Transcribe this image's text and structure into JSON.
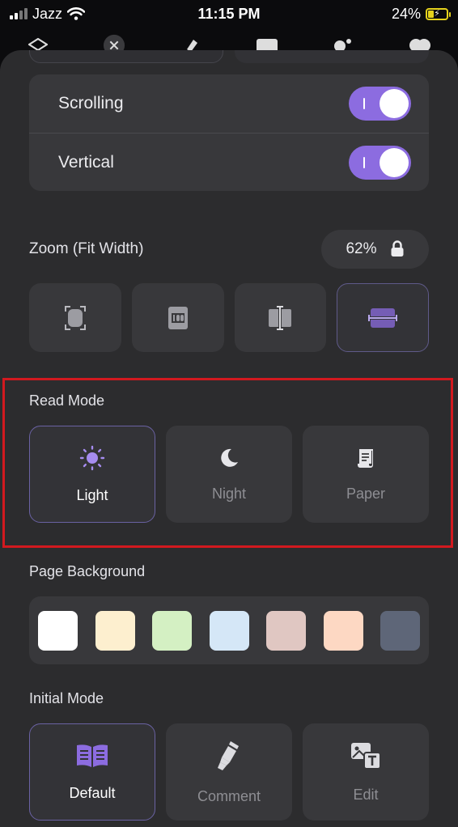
{
  "status_bar": {
    "carrier": "Jazz",
    "time": "11:15 PM",
    "battery_percent": "24%",
    "battery_level": 0.24,
    "battery_color": "#e5d21c"
  },
  "toolbar": {
    "icons": [
      "layers-icon",
      "close-icon",
      "highlighter-icon",
      "image-icon",
      "sparkles-icon",
      "bookmark-icon"
    ]
  },
  "scrolling_card": {
    "rows": [
      {
        "label": "Scrolling",
        "on": true
      },
      {
        "label": "Vertical",
        "on": true
      }
    ],
    "accent": "#8c6ce0"
  },
  "zoom": {
    "label": "Zoom (Fit Width)",
    "value": "62%",
    "lock_icon": "lock-icon",
    "buttons": [
      {
        "icon": "fit-page-icon",
        "active": false
      },
      {
        "icon": "actual-size-icon",
        "active": false
      },
      {
        "icon": "fit-height-icon",
        "active": false
      },
      {
        "icon": "fit-width-icon",
        "active": true
      }
    ]
  },
  "read_mode": {
    "title": "Read Mode",
    "options": [
      {
        "label": "Light",
        "icon": "sun-icon",
        "active": true
      },
      {
        "label": "Night",
        "icon": "moon-icon",
        "active": false
      },
      {
        "label": "Paper",
        "icon": "scroll-icon",
        "active": false
      }
    ]
  },
  "page_background": {
    "title": "Page Background",
    "swatches": [
      "#ffffff",
      "#fdefcf",
      "#d4f0c3",
      "#d5e7f7",
      "#e0c7c2",
      "#fdd8c3",
      "#5e6678"
    ]
  },
  "initial_mode": {
    "title": "Initial Mode",
    "options": [
      {
        "label": "Default",
        "icon": "open-book-icon",
        "active": true
      },
      {
        "label": "Comment",
        "icon": "marker-icon",
        "active": false
      },
      {
        "label": "Edit",
        "icon": "edit-text-icon",
        "active": false
      }
    ]
  }
}
